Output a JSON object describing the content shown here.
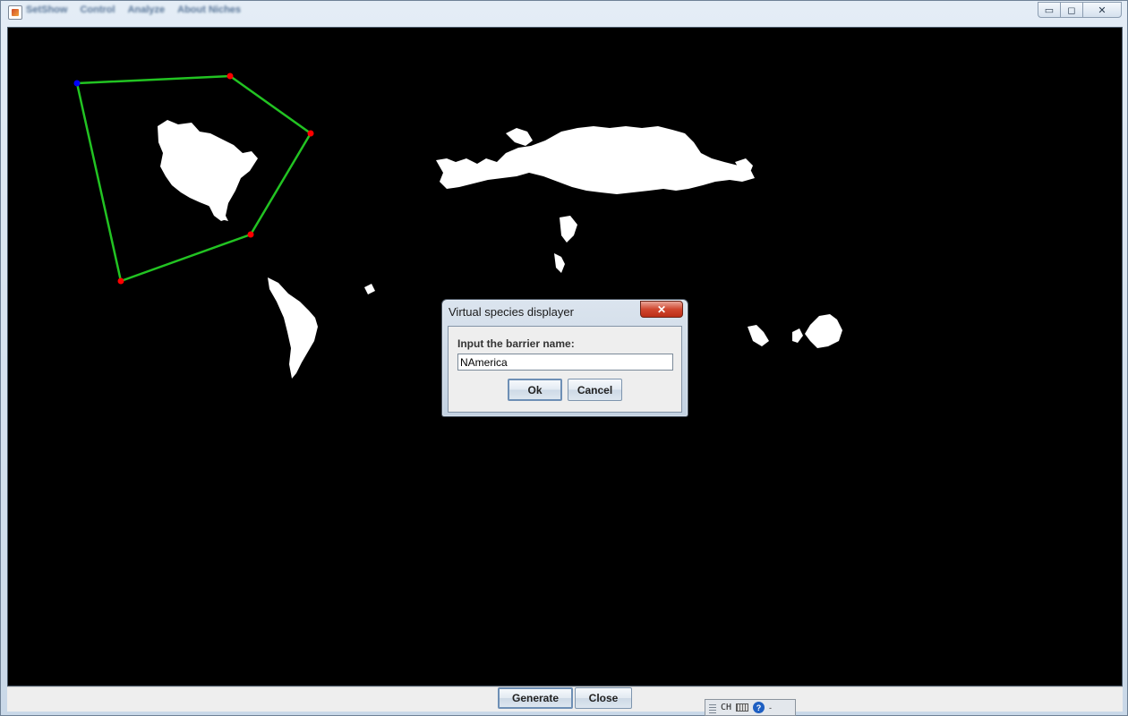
{
  "window": {
    "menu": [
      "SetShow",
      "Control",
      "Analyze",
      "About Niches"
    ],
    "controls": {
      "minimize": "▭",
      "restore": "◻",
      "close": "✕"
    }
  },
  "footer": {
    "generate_label": "Generate",
    "close_label": "Close"
  },
  "dialog": {
    "title": "Virtual species displayer",
    "close_glyph": "✕",
    "prompt": "Input the barrier name:",
    "input_value": "NAmerica",
    "ok_label": "Ok",
    "cancel_label": "Cancel"
  },
  "tray": {
    "lang": "CH",
    "help": "?",
    "minimize": "-"
  },
  "colors": {
    "map_background": "#000000",
    "land": "#ffffff",
    "barrier_line": "#22c322",
    "vertex": "#ff0000",
    "start_vertex": "#0000ff"
  }
}
